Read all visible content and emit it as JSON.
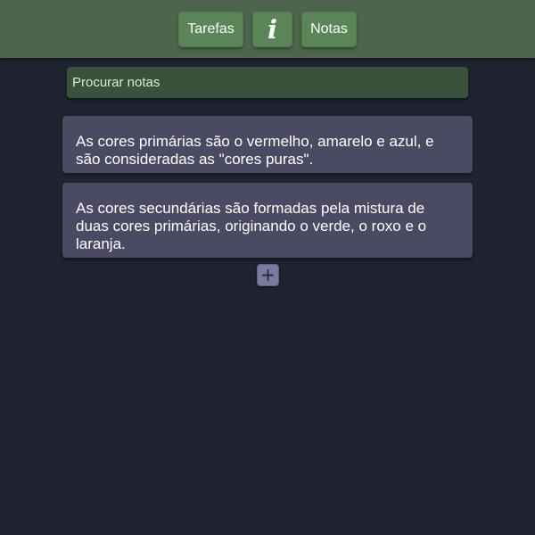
{
  "nav": {
    "tarefas_label": "Tarefas",
    "info_label": "i",
    "notas_label": "Notas"
  },
  "search": {
    "placeholder": "Procurar notas",
    "value": ""
  },
  "notes": [
    {
      "text": "As cores primárias são o vermelho, amarelo e azul, e são consideradas as \"cores puras\"."
    },
    {
      "text": "As cores secundárias são formadas pela mistura de duas cores primárias, originando o verde, o roxo e o laranja."
    }
  ],
  "add_button": {
    "label": "+",
    "icon": "plus-icon"
  },
  "colors": {
    "background": "#1f2430",
    "topbar": "#4d654c",
    "nav_button": "#5a8657",
    "search_bg": "#39533a",
    "note_bg": "#4a4a63",
    "add_button_bg": "#7a7aa0"
  }
}
